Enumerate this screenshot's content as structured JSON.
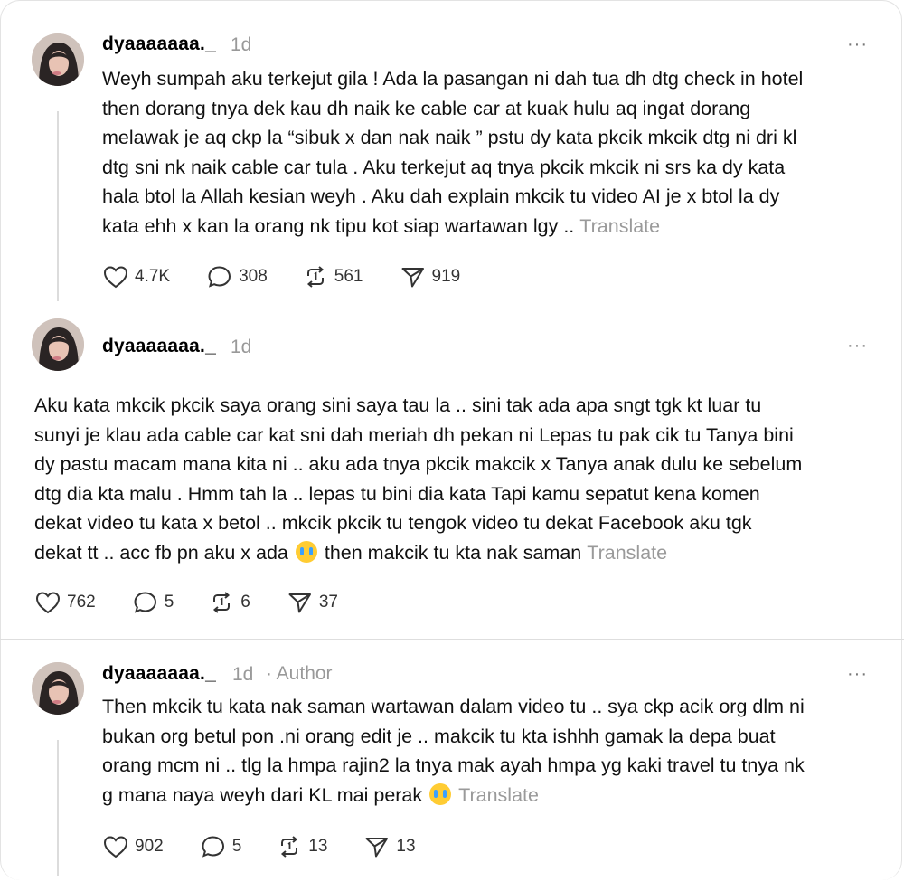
{
  "posts": [
    {
      "username": "dyaaaaaaa._",
      "time": "1d",
      "author_badge": "",
      "lines": [
        "Weyh sumpah aku terkejut gila ! Ada la pasangan ni dah tua dh dtg check in hotel",
        "then dorang tnya dek kau dh naik ke cable car at kuak hulu aq ingat dorang",
        "melawak je aq ckp la “sibuk x dan nak naik ” pstu dy kata pkcik mkcik dtg ni dri kl",
        "dtg sni nk naik cable car tula . Aku terkejut aq tnya pkcik mkcik ni srs ka dy kata",
        "hala btol la Allah kesian weyh . Aku dah explain mkcik tu video AI je x btol la dy",
        "kata ehh x kan la orang nk tipu kot siap wartawan lgy .."
      ],
      "translate": "Translate",
      "likes": "4.7K",
      "replies": "308",
      "reposts": "561",
      "shares": "919"
    },
    {
      "username": "dyaaaaaaa._",
      "time": "1d",
      "lines": [
        "Aku kata mkcik pkcik saya orang sini saya tau la .. sini tak ada apa sngt tgk kt luar tu",
        "sunyi je klau ada cable car kat sni dah meriah dh pekan ni Lepas tu pak cik tu Tanya bini",
        "dy pastu macam mana kita ni .. aku ada tnya pkcik makcik x Tanya anak dulu ke sebelum",
        "dtg dia kta malu . Hmm tah la .. lepas tu bini dia kata Tapi kamu sepatut kena komen",
        "dekat video tu kata x betol .. mkcik pkcik tu tengok video tu dekat Facebook aku tgk",
        "dekat tt .. acc fb pn aku x ada"
      ],
      "last_line_after_emoji": "then makcik tu kta nak saman",
      "translate": "Translate",
      "likes": "762",
      "replies": "5",
      "reposts": "6",
      "shares": "37"
    },
    {
      "username": "dyaaaaaaa._",
      "time": "1d",
      "author_badge": "· Author",
      "lines": [
        "Then mkcik tu kata nak saman wartawan dalam video tu .. sya ckp acik org dlm ni",
        "bukan org betul pon .ni orang edit je .. makcik tu kta ishhh gamak la depa buat",
        "orang mcm ni .. tlg la hmpa rajin2 la tnya mak ayah hmpa yg kaki travel tu tnya nk",
        "g mana naya weyh dari KL mai perak"
      ],
      "translate": "Translate",
      "likes": "902",
      "replies": "5",
      "reposts": "13",
      "shares": "13"
    }
  ],
  "more_label": "···",
  "icons": {
    "like": "heart-icon",
    "reply": "comment-icon",
    "repost": "repost-icon",
    "share": "send-icon",
    "emoji": "loudly-crying-face-emoji"
  }
}
